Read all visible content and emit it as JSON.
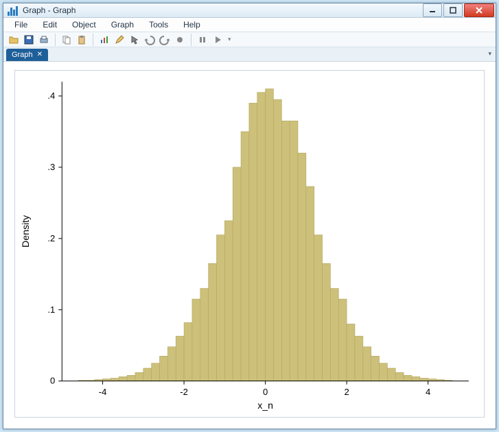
{
  "window": {
    "title": "Graph - Graph"
  },
  "menu": {
    "items": [
      "File",
      "Edit",
      "Object",
      "Graph",
      "Tools",
      "Help"
    ]
  },
  "tab": {
    "label": "Graph"
  },
  "toolbar": {
    "buttons": [
      {
        "name": "open-icon",
        "glyph": "folder"
      },
      {
        "name": "save-icon",
        "glyph": "disk"
      },
      {
        "name": "print-icon",
        "glyph": "printer"
      },
      {
        "name": "copy-icon",
        "glyph": "copy"
      },
      {
        "name": "paste-icon",
        "glyph": "paste"
      },
      {
        "name": "chart-icon",
        "glyph": "bars"
      },
      {
        "name": "edit-icon",
        "glyph": "pencil"
      },
      {
        "name": "pointer-icon",
        "glyph": "pointer"
      },
      {
        "name": "undo-icon",
        "glyph": "undo"
      },
      {
        "name": "redo-icon",
        "glyph": "redo"
      },
      {
        "name": "record-icon",
        "glyph": "record"
      },
      {
        "name": "pause-icon",
        "glyph": "pause"
      },
      {
        "name": "play-icon",
        "glyph": "play"
      }
    ]
  },
  "chart_data": {
    "type": "bar",
    "title": "",
    "xlabel": "x_n",
    "ylabel": "Density",
    "xlim": [
      -5,
      5
    ],
    "ylim": [
      0,
      0.42
    ],
    "xticks": [
      -4,
      -2,
      0,
      2,
      4
    ],
    "yticks": [
      0,
      0.1,
      0.2,
      0.3,
      0.4
    ],
    "ytick_labels": [
      "0",
      ".1",
      ".2",
      ".3",
      ".4"
    ],
    "bin_width": 0.2,
    "categories": [
      -4.5,
      -4.3,
      -4.1,
      -3.9,
      -3.7,
      -3.5,
      -3.3,
      -3.1,
      -2.9,
      -2.7,
      -2.5,
      -2.3,
      -2.1,
      -1.9,
      -1.7,
      -1.5,
      -1.3,
      -1.1,
      -0.9,
      -0.7,
      -0.5,
      -0.3,
      -0.1,
      0.1,
      0.3,
      0.5,
      0.7,
      0.9,
      1.1,
      1.3,
      1.5,
      1.7,
      1.9,
      2.1,
      2.3,
      2.5,
      2.7,
      2.9,
      3.1,
      3.3,
      3.5,
      3.7,
      3.9,
      4.1,
      4.3,
      4.5
    ],
    "values": [
      0.001,
      0.001,
      0.002,
      0.003,
      0.004,
      0.006,
      0.008,
      0.012,
      0.018,
      0.025,
      0.035,
      0.048,
      0.063,
      0.082,
      0.115,
      0.13,
      0.165,
      0.205,
      0.225,
      0.3,
      0.35,
      0.39,
      0.405,
      0.41,
      0.395,
      0.365,
      0.365,
      0.32,
      0.273,
      0.205,
      0.165,
      0.13,
      0.115,
      0.08,
      0.063,
      0.048,
      0.035,
      0.025,
      0.018,
      0.012,
      0.008,
      0.006,
      0.004,
      0.003,
      0.002,
      0.001
    ],
    "bar_color": "#ccc07a",
    "bar_stroke": "#b3a760"
  }
}
